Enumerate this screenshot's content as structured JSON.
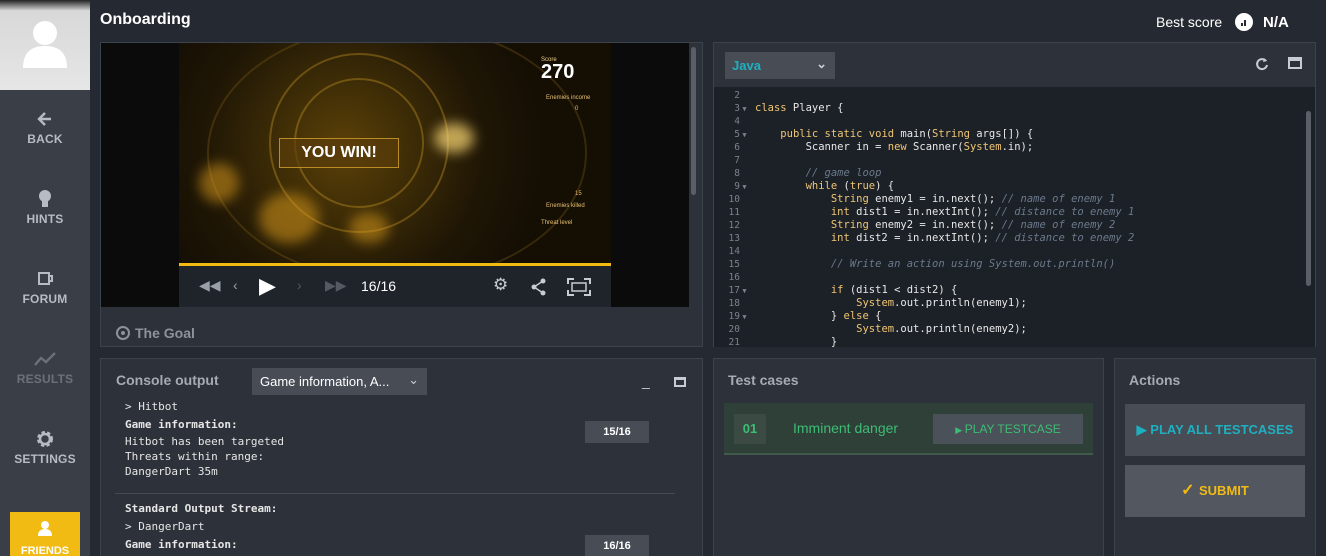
{
  "header": {
    "title": "Onboarding",
    "best_score_label": "Best score",
    "best_score_value": "N/A"
  },
  "sidebar": {
    "items": [
      {
        "label": "BACK",
        "icon": "arrow-left-icon"
      },
      {
        "label": "HINTS",
        "icon": "bulb-icon"
      },
      {
        "label": "FORUM",
        "icon": "mug-icon"
      },
      {
        "label": "RESULTS",
        "icon": "chart-icon",
        "disabled": true
      },
      {
        "label": "SETTINGS",
        "icon": "gear-icon"
      },
      {
        "label": "FRIENDS",
        "icon": "user-icon"
      }
    ]
  },
  "viewer": {
    "score_label": "Score",
    "score_value": "270",
    "banner": "YOU WIN!",
    "hud_enemies_income": "Enemies income",
    "hud_enemies_killed": "Enemies killed",
    "hud_threat_level": "Threat level",
    "hud_income_value": "0",
    "hud_killed_value": "15",
    "frame": "16/16",
    "goal_label": "The Goal"
  },
  "editor": {
    "language": "Java",
    "lines": [
      {
        "n": "2",
        "fold": false,
        "html": ""
      },
      {
        "n": "3",
        "fold": true,
        "html": "<span class='kw'>class</span> Player {"
      },
      {
        "n": "4",
        "fold": false,
        "html": ""
      },
      {
        "n": "5",
        "fold": true,
        "html": "    <span class='kw'>public static void</span> main(<span class='kw'>String</span> args[]) {"
      },
      {
        "n": "6",
        "fold": false,
        "html": "        Scanner in = <span class='kw'>new</span> Scanner(<span class='kw'>System</span>.in);"
      },
      {
        "n": "7",
        "fold": false,
        "html": ""
      },
      {
        "n": "8",
        "fold": false,
        "html": "        <span class='cm'>// game loop</span>"
      },
      {
        "n": "9",
        "fold": true,
        "html": "        <span class='kw'>while</span> (<span class='kw'>true</span>) {"
      },
      {
        "n": "10",
        "fold": false,
        "html": "            <span class='kw'>String</span> enemy1 = in.next(); <span class='cm'>// name of enemy 1</span>"
      },
      {
        "n": "11",
        "fold": false,
        "html": "            <span class='kw'>int</span> dist1 = in.nextInt(); <span class='cm'>// distance to enemy 1</span>"
      },
      {
        "n": "12",
        "fold": false,
        "html": "            <span class='kw'>String</span> enemy2 = in.next(); <span class='cm'>// name of enemy 2</span>"
      },
      {
        "n": "13",
        "fold": false,
        "html": "            <span class='kw'>int</span> dist2 = in.nextInt(); <span class='cm'>// distance to enemy 2</span>"
      },
      {
        "n": "14",
        "fold": false,
        "html": ""
      },
      {
        "n": "15",
        "fold": false,
        "html": "            <span class='cm'>// Write an action using System.out.println()</span>"
      },
      {
        "n": "16",
        "fold": false,
        "html": ""
      },
      {
        "n": "17",
        "fold": true,
        "html": "            <span class='kw'>if</span> (dist1 &lt; dist2) {"
      },
      {
        "n": "18",
        "fold": false,
        "html": "                <span class='kw'>System</span>.out.println(enemy1);"
      },
      {
        "n": "19",
        "fold": true,
        "html": "            } <span class='kw'>else</span> {"
      },
      {
        "n": "20",
        "fold": false,
        "html": "                <span class='kw'>System</span>.out.println(enemy2);"
      },
      {
        "n": "21",
        "fold": false,
        "html": "            }"
      }
    ]
  },
  "console": {
    "title": "Console output",
    "filter": "Game information, A...",
    "block1": {
      "line_hitbot": "> Hitbot",
      "game_info_label": "Game information:",
      "info_lines": "Hitbot has been targeted\nThreats within range:\nDangerDart 35m",
      "turn": "15/16"
    },
    "block2": {
      "stdout_label": "Standard Output Stream:",
      "line_dart": "> DangerDart",
      "game_info_label": "Game information:",
      "turn": "16/16"
    }
  },
  "tests": {
    "title": "Test cases",
    "cases": [
      {
        "num": "01",
        "name": "Imminent danger",
        "play_label": "PLAY TESTCASE"
      }
    ]
  },
  "actions": {
    "title": "Actions",
    "play_all": "PLAY ALL TESTCASES",
    "submit": "SUBMIT"
  },
  "colors": {
    "accent": "#f2bb13",
    "cyan": "#1fb0c0",
    "green": "#3dbd74",
    "bg": "#252a32",
    "panel": "#2c313a"
  }
}
